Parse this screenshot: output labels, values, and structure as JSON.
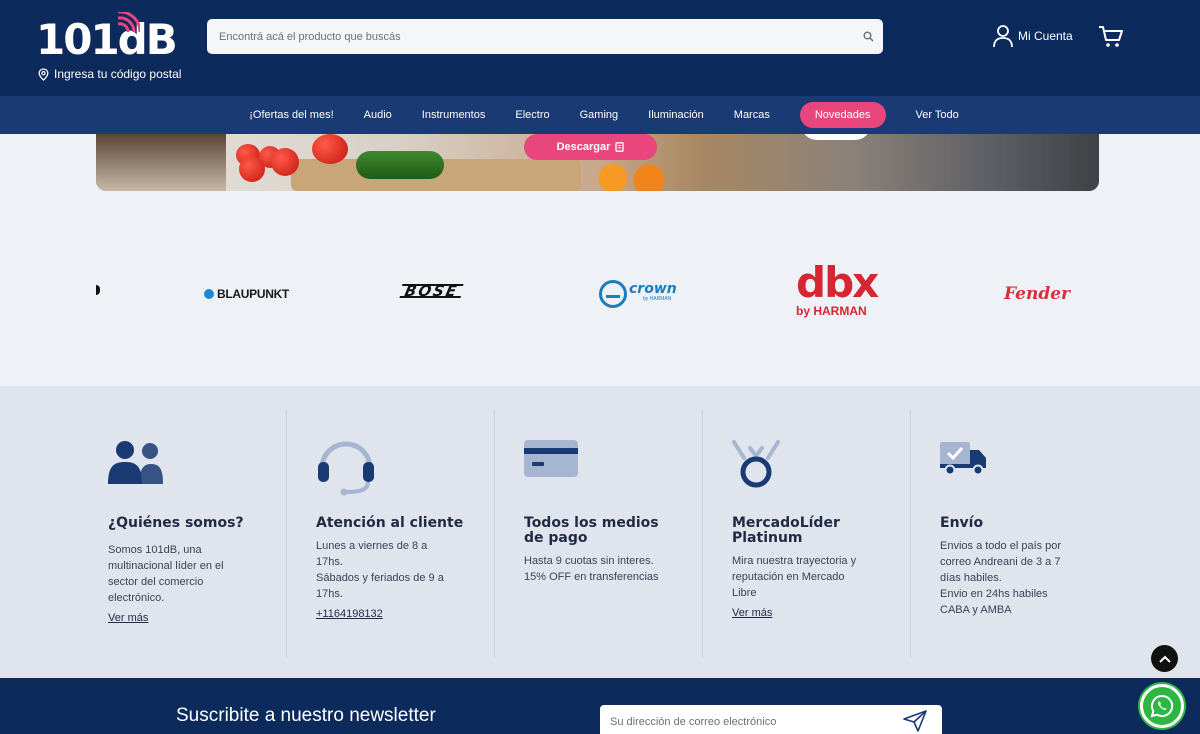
{
  "header": {
    "logo_text": "101dB",
    "postal_label": "Ingresa tu código postal",
    "search_placeholder": "Encontrá acá el producto que buscás",
    "account_label": "Mi Cuenta"
  },
  "nav": {
    "items": [
      "¡Ofertas del mes!",
      "Audio",
      "Instrumentos",
      "Electro",
      "Gaming",
      "Iluminación",
      "Marcas",
      "Novedades",
      "Ver Todo"
    ]
  },
  "banner": {
    "download_label": "Descargar"
  },
  "brands": {
    "blaupunkt": "BLAUPUNKT",
    "bose": "BOSE",
    "crown": "crown",
    "crown_sub": "by HARMAN",
    "dbx": "dbx",
    "dbx_sub": "by HARMAN",
    "fender": "Fender"
  },
  "info": {
    "columns": [
      {
        "title": "¿Quiénes somos?",
        "text": [
          "Somos 101dB, una",
          "multinacional líder en el",
          "sector del comercio",
          "electrónico."
        ],
        "link": "Ver más"
      },
      {
        "title": "Atención al cliente",
        "text": [
          "Lunes a viernes de 8 a",
          "17hs.",
          "Sábados y feriados de 9 a",
          "17hs."
        ],
        "link": "+1164198132"
      },
      {
        "title": "Todos los medios de pago",
        "title_lines": [
          "Todos los medios",
          "de pago"
        ],
        "text": [
          "Hasta 9 cuotas sin interes.",
          "15% OFF en transferencias"
        ]
      },
      {
        "title": "MercadoLíder Platinum",
        "title_lines": [
          "MercadoLíder",
          "Platinum"
        ],
        "text": [
          "Mira nuestra trayectoria y",
          "reputación en Mercado",
          "Libre"
        ],
        "link": "Ver más"
      },
      {
        "title": "Envío",
        "text": [
          "Envios a todo el país por",
          "correo Andreani de 3 a 7",
          "días habiles.",
          "Envio en 24hs habiles",
          "CABA y AMBA"
        ]
      }
    ]
  },
  "newsletter": {
    "title": "Suscribite a nuestro newsletter",
    "placeholder": "Su dirección de correo electrónico"
  },
  "colors": {
    "navy": "#0d2a5c",
    "nav_blue": "#1a3a73",
    "pink": "#e8467c",
    "info_bg": "#dfe4ed",
    "whatsapp": "#2db742"
  }
}
